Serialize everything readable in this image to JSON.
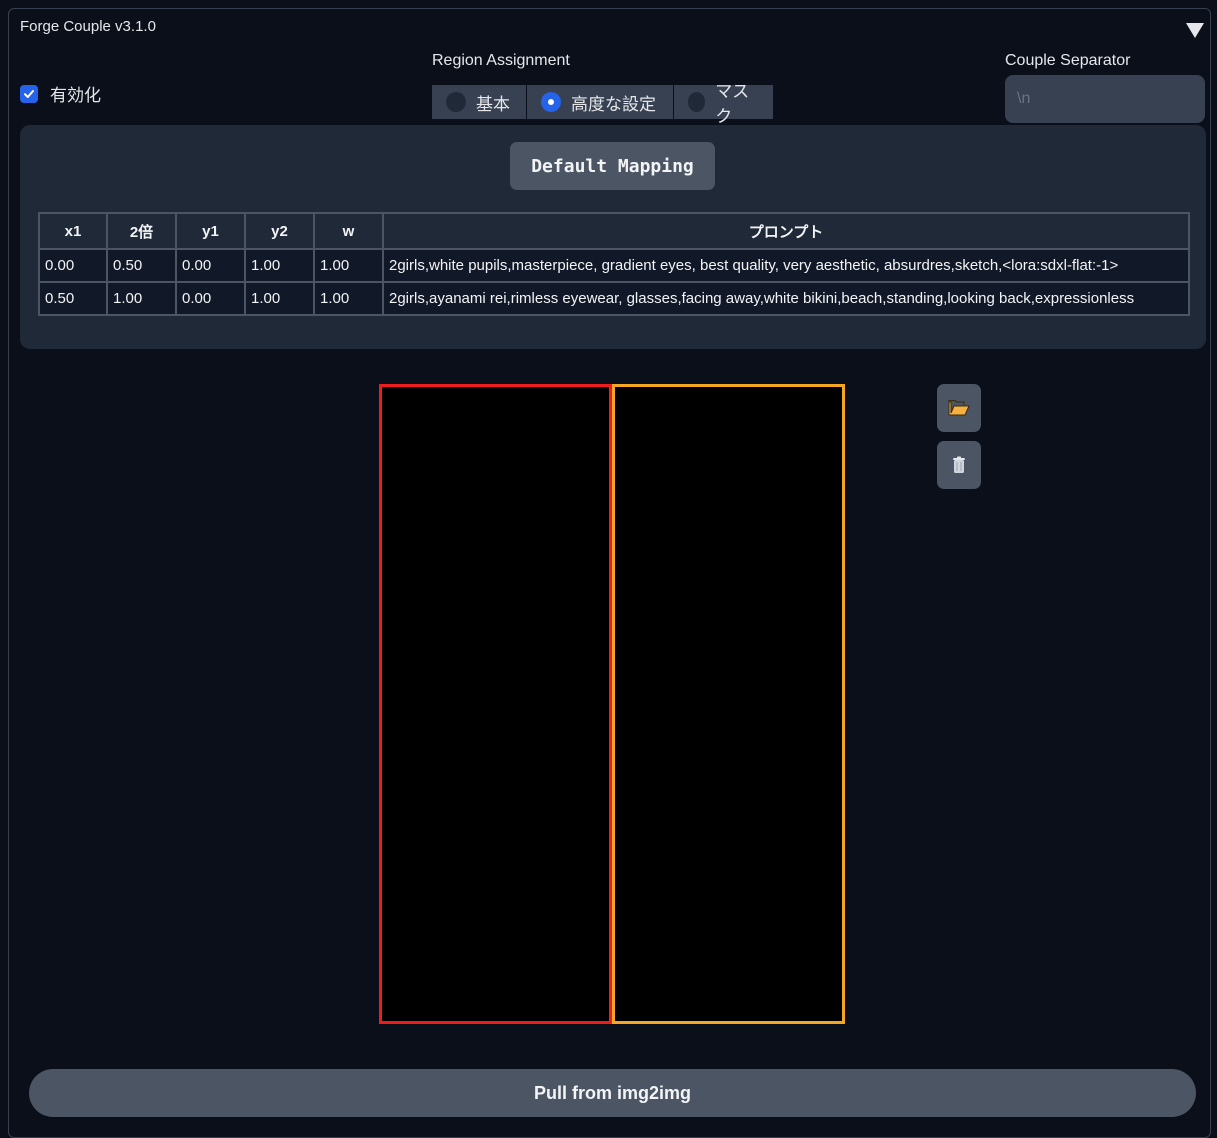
{
  "header": {
    "title": "Forge Couple v3.1.0"
  },
  "enable": {
    "label": "有効化",
    "checked": true
  },
  "region_assignment": {
    "label": "Region Assignment",
    "options": [
      "基本",
      "高度な設定",
      "マスク"
    ],
    "selected": "高度な設定"
  },
  "separator": {
    "label": "Couple Separator",
    "placeholder": "\\n"
  },
  "mapping": {
    "default_button": "Default Mapping",
    "columns": [
      "x1",
      "2倍",
      "y1",
      "y2",
      "w",
      "プロンプト"
    ],
    "rows": [
      [
        "0.00",
        "0.50",
        "0.00",
        "1.00",
        "1.00",
        "2girls,white pupils,masterpiece, gradient eyes, best quality, very aesthetic, absurdres,sketch,<lora:sdxl-flat:-1>"
      ],
      [
        "0.50",
        "1.00",
        "0.00",
        "1.00",
        "1.00",
        "2girls,ayanami rei,rimless eyewear, glasses,facing away,white bikini,beach,standing,looking back,expressionless"
      ]
    ],
    "region_colors": [
      "#ef1c1c",
      "#f5a623"
    ]
  },
  "tools": {
    "upload_icon": "folder-open-icon",
    "clear_icon": "trash-icon"
  },
  "footer": {
    "pull_button": "Pull from img2img"
  }
}
